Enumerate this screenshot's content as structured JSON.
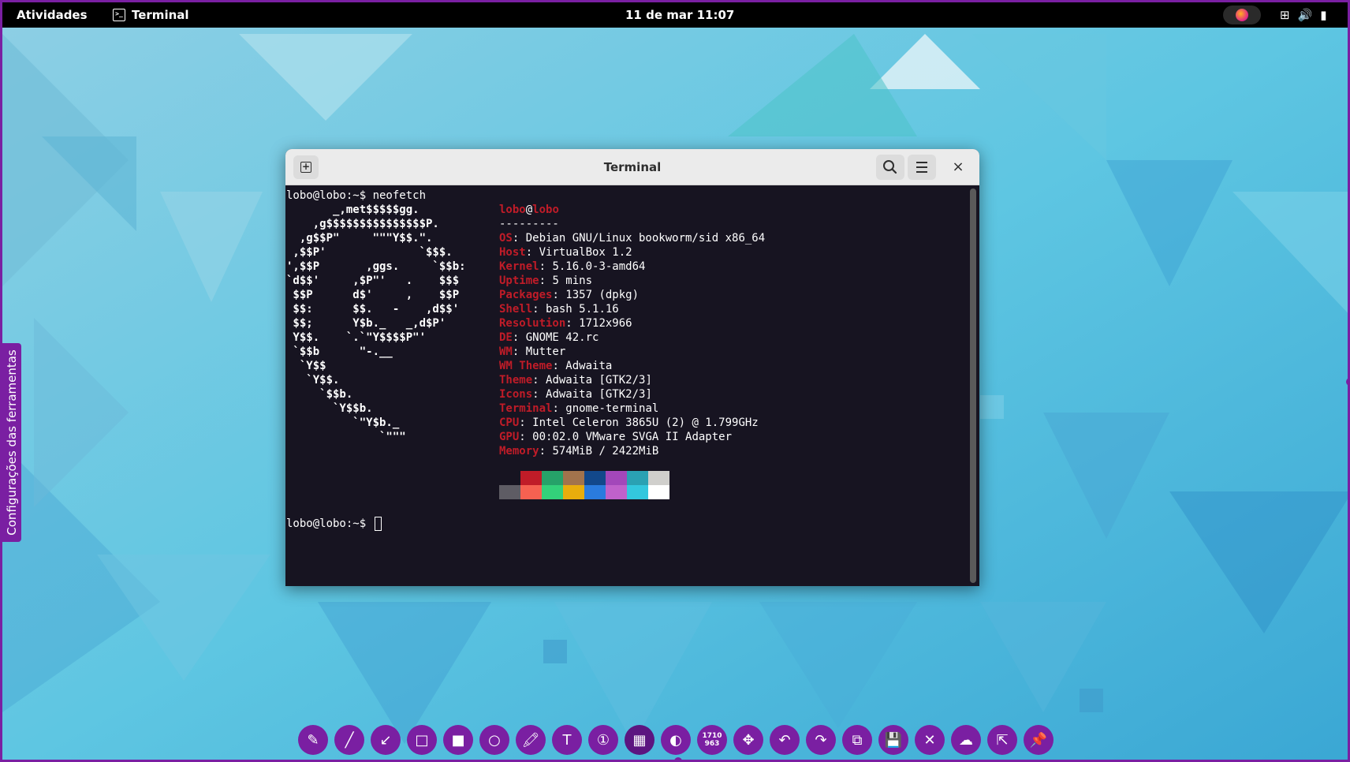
{
  "topbar": {
    "activities": "Atividades",
    "app_name": "Terminal",
    "app_icon": "terminal-icon",
    "clock": "11 de mar  11:07",
    "indicator_icon": "screenshot-tool-icon",
    "icons": [
      {
        "name": "network-icon",
        "glyph": "⊞"
      },
      {
        "name": "volume-icon",
        "glyph": "🔊"
      },
      {
        "name": "battery-icon",
        "glyph": "▮"
      }
    ]
  },
  "side_tab": {
    "label": "Configurações das ferramentas"
  },
  "window": {
    "title": "Terminal",
    "new_tab_icon": "new-tab-icon",
    "search_icon": "search-icon",
    "menu_icon": "hamburger-menu-icon",
    "close_glyph": "×"
  },
  "terminal": {
    "prompt": "lobo@lobo:~$ ",
    "command": "neofetch",
    "logo_lines": [
      "       _,met$$$$$gg.",
      "    ,g$$$$$$$$$$$$$$$P.",
      "  ,g$$P\"     \"\"\"Y$$.\".",
      " ,$$P'              `$$$.",
      "',$$P       ,ggs.     `$$b:",
      "`d$$'     ,$P\"'   .    $$$",
      " $$P      d$'     ,    $$P",
      " $$:      $$.   -    ,d$$'",
      " $$;      Y$b._   _,d$P'",
      " Y$$.    `.`\"Y$$$$P\"'",
      " `$$b      \"-.__",
      "  `Y$$",
      "   `Y$$.",
      "     `$$b.",
      "       `Y$$b.",
      "          `\"Y$b._",
      "              `\"\"\""
    ],
    "user": "lobo",
    "at": "@",
    "host": "lobo",
    "separator": "---------",
    "info": [
      {
        "key": "OS",
        "value": "Debian GNU/Linux bookworm/sid x86_64"
      },
      {
        "key": "Host",
        "value": "VirtualBox 1.2"
      },
      {
        "key": "Kernel",
        "value": "5.16.0-3-amd64"
      },
      {
        "key": "Uptime",
        "value": "5 mins"
      },
      {
        "key": "Packages",
        "value": "1357 (dpkg)"
      },
      {
        "key": "Shell",
        "value": "bash 5.1.16"
      },
      {
        "key": "Resolution",
        "value": "1712x966"
      },
      {
        "key": "DE",
        "value": "GNOME 42.rc"
      },
      {
        "key": "WM",
        "value": "Mutter"
      },
      {
        "key": "WM Theme",
        "value": "Adwaita"
      },
      {
        "key": "Theme",
        "value": "Adwaita [GTK2/3]"
      },
      {
        "key": "Icons",
        "value": "Adwaita [GTK2/3]"
      },
      {
        "key": "Terminal",
        "value": "gnome-terminal"
      },
      {
        "key": "CPU",
        "value": "Intel Celeron 3865U (2) @ 1.799GHz"
      },
      {
        "key": "GPU",
        "value": "00:02.0 VMware SVGA II Adapter"
      },
      {
        "key": "Memory",
        "value": "574MiB / 2422MiB"
      }
    ],
    "palette_top": [
      "#171421",
      "#c01c28",
      "#26a269",
      "#a2734c",
      "#12488b",
      "#a347ba",
      "#2aa1b3",
      "#d0cfcc"
    ],
    "palette_bottom": [
      "#5e5c64",
      "#f66151",
      "#33d17a",
      "#e9ad0c",
      "#2a7bde",
      "#c061cb",
      "#33c7de",
      "#ffffff"
    ],
    "second_prompt": "lobo@lobo:~$ "
  },
  "toolbar": {
    "tools": [
      {
        "name": "pencil-tool-icon",
        "glyph": "✎"
      },
      {
        "name": "line-tool-icon",
        "glyph": "╱"
      },
      {
        "name": "arrow-tool-icon",
        "glyph": "↙"
      },
      {
        "name": "rectangle-tool-icon",
        "glyph": "□"
      },
      {
        "name": "filled-rectangle-tool-icon",
        "glyph": "■"
      },
      {
        "name": "circle-tool-icon",
        "glyph": "○"
      },
      {
        "name": "marker-tool-icon",
        "glyph": "🖍"
      },
      {
        "name": "text-tool-icon",
        "glyph": "T"
      },
      {
        "name": "counter-tool-icon",
        "glyph": "①"
      },
      {
        "name": "pixelate-tool-icon",
        "glyph": "▦"
      },
      {
        "name": "invert-tool-icon",
        "glyph": "◐"
      },
      {
        "name": "size-indicator",
        "glyph": "",
        "dims": [
          "1710",
          "963"
        ]
      },
      {
        "name": "move-tool-icon",
        "glyph": "✥"
      },
      {
        "name": "undo-icon",
        "glyph": "↶"
      },
      {
        "name": "redo-icon",
        "glyph": "↷"
      },
      {
        "name": "copy-icon",
        "glyph": "⧉"
      },
      {
        "name": "save-icon",
        "glyph": "💾"
      },
      {
        "name": "exit-icon",
        "glyph": "✕"
      },
      {
        "name": "upload-icon",
        "glyph": "☁"
      },
      {
        "name": "open-with-app-icon",
        "glyph": "⇱"
      },
      {
        "name": "pin-icon",
        "glyph": "📌"
      }
    ]
  }
}
